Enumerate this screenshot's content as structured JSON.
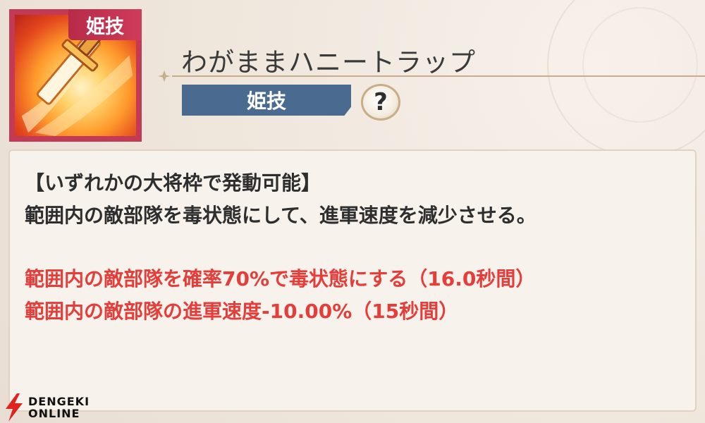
{
  "skill": {
    "icon_name": "sword-icon",
    "icon_tag": "姫技",
    "title": "わがままハニートラップ",
    "type_badge": "姫技",
    "help_label": "?"
  },
  "description": {
    "condition": "【いずれかの大将枠で発動可能】",
    "summary": "範囲内の敵部隊を毒状態にして、進軍速度を減少させる。",
    "effects": [
      "範囲内の敵部隊を確率70%で毒状態にする（16.0秒間）",
      "範囲内の敵部隊の進軍速度-10.00%（15秒間）"
    ]
  },
  "watermark": {
    "line1": "DENGEKI",
    "line2": "ONLINE"
  },
  "colors": {
    "badge": "#4a6b8f",
    "tag": "#c23a55",
    "effect_text": "#e53d3a"
  }
}
